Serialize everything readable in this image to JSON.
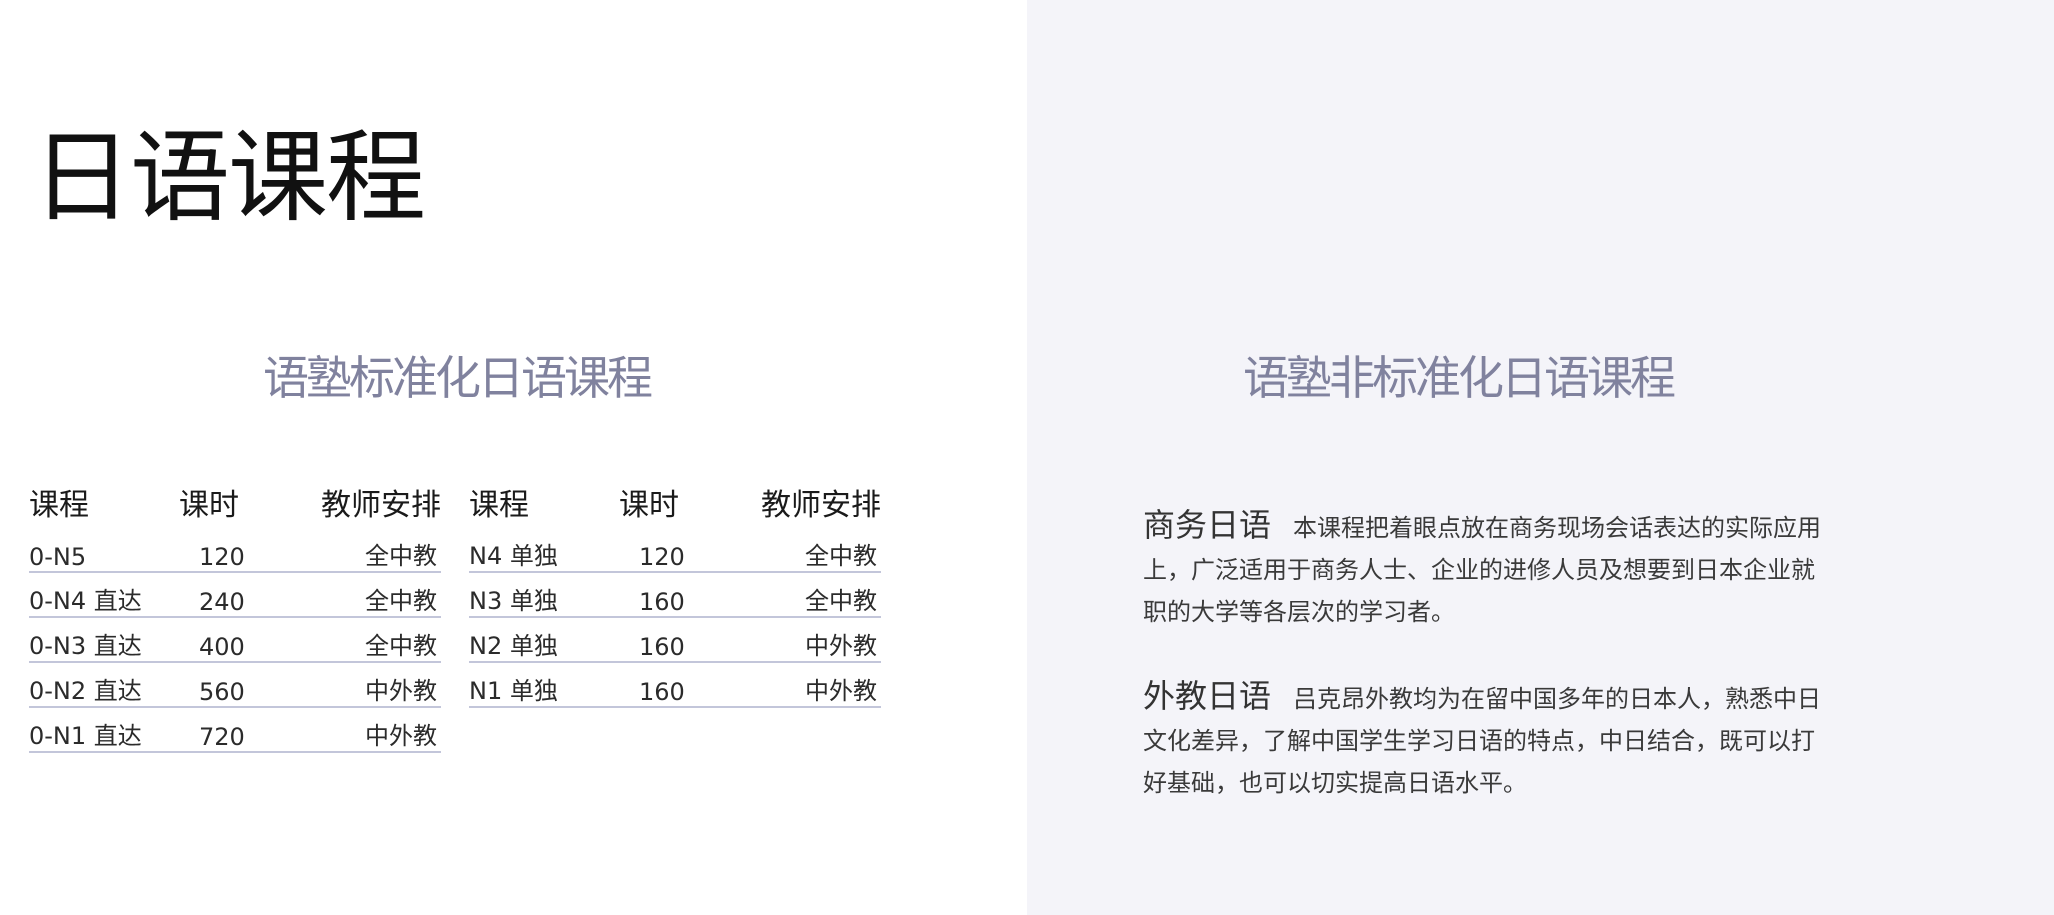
{
  "title": "日语课程",
  "left_section": {
    "heading": "语塾标准化日语课程",
    "columns": [
      "课程",
      "课时",
      "教师安排"
    ],
    "table1": [
      {
        "course": "0-N5",
        "hours": "120",
        "teacher": "全中教"
      },
      {
        "course": "0-N4 直达",
        "hours": "240",
        "teacher": "全中教"
      },
      {
        "course": "0-N3 直达",
        "hours": "400",
        "teacher": "全中教"
      },
      {
        "course": "0-N2 直达",
        "hours": "560",
        "teacher": "中外教"
      },
      {
        "course": "0-N1 直达",
        "hours": "720",
        "teacher": "中外教"
      }
    ],
    "table2": [
      {
        "course": "N4 单独",
        "hours": "120",
        "teacher": "全中教"
      },
      {
        "course": "N3 单独",
        "hours": "160",
        "teacher": "全中教"
      },
      {
        "course": "N2 单独",
        "hours": "160",
        "teacher": "中外教"
      },
      {
        "course": "N1 单独",
        "hours": "160",
        "teacher": "中外教"
      }
    ]
  },
  "right_section": {
    "heading": "语塾非标准化日语课程",
    "blocks": [
      {
        "title": "商务日语",
        "text": "本课程把着眼点放在商务现场会话表达的实际应用上，广泛适用于商务人士、企业的进修人员及想要到日本企业就职的大学等各层次的学习者。"
      },
      {
        "title": "外教日语",
        "text": "吕克昂外教均为在留中国多年的日本人，熟悉中日文化差异，了解中国学生学习日语的特点，中日结合，既可以打好基础，也可以切实提高日语水平。"
      }
    ]
  },
  "colors": {
    "right_panel_bg": "#f4f4f9",
    "subtitle": "#80829e",
    "row_rule": "#c3c6da"
  }
}
